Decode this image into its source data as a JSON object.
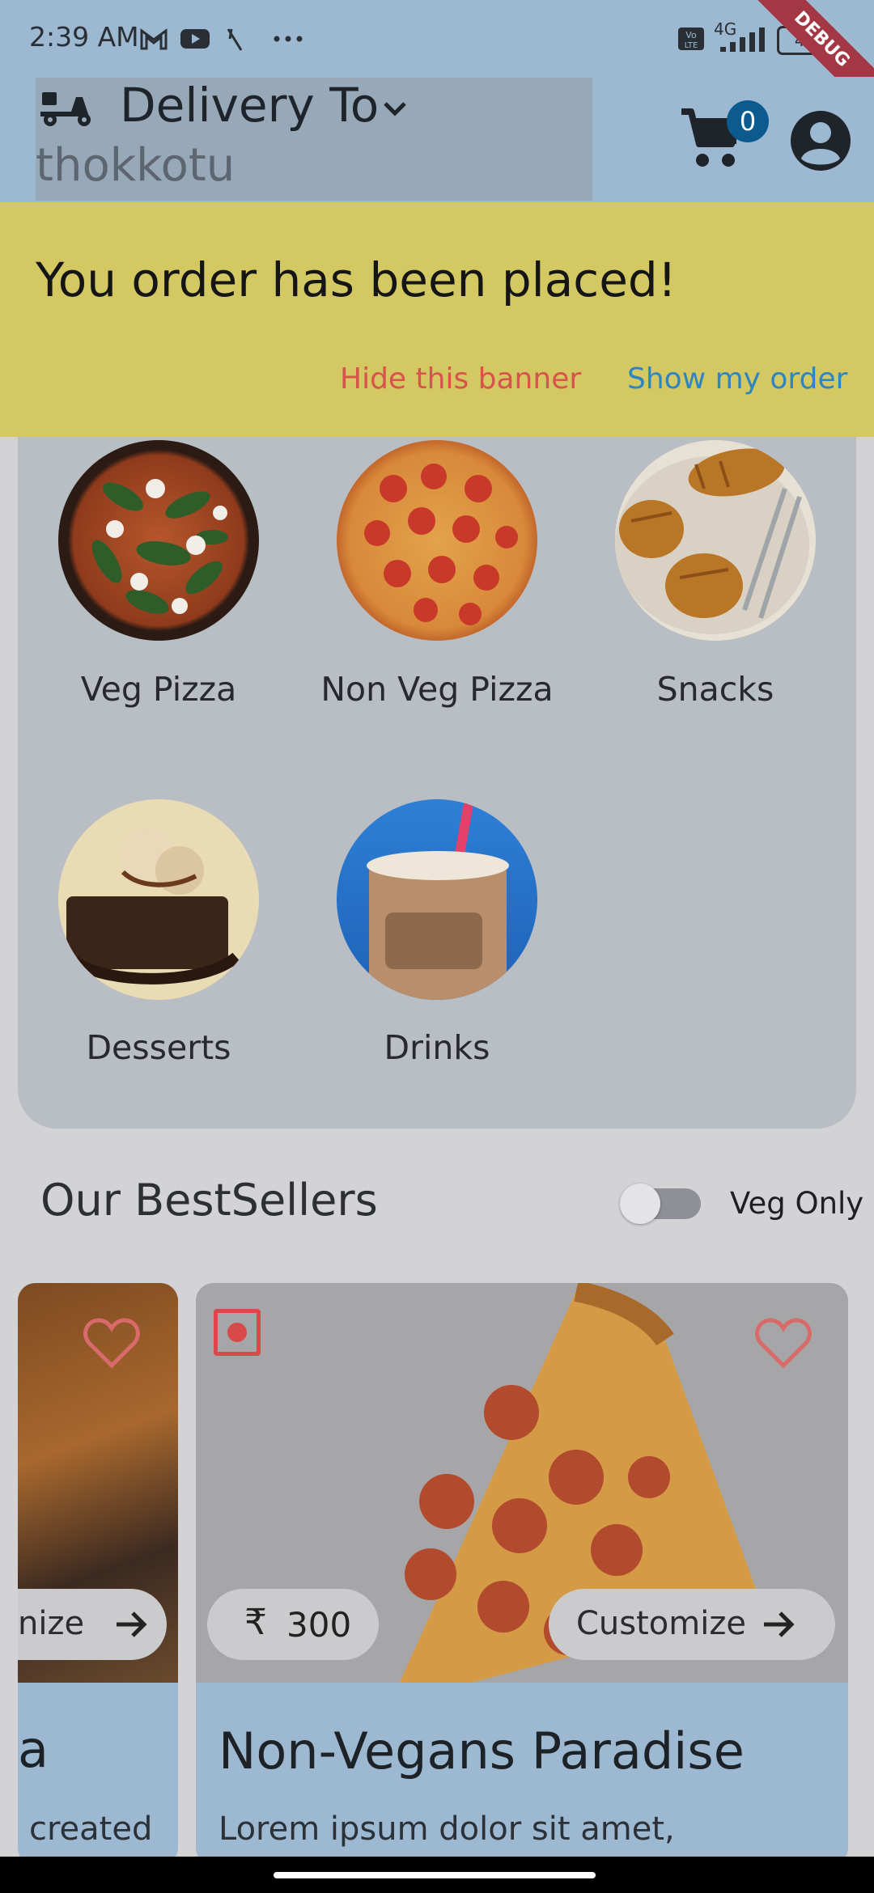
{
  "status_bar": {
    "time": "2:39 AM",
    "network": "4G",
    "battery": "4G"
  },
  "app_bar": {
    "delivery_label": "Delivery To",
    "location": "thokkotu",
    "cart_count": "0",
    "debug_ribbon": "DEBUG"
  },
  "banner": {
    "message": "You order has been placed!",
    "hide_label": "Hide this banner",
    "show_label": "Show my order"
  },
  "categories": [
    {
      "label": "Veg Pizza"
    },
    {
      "label": "Non Veg Pizza"
    },
    {
      "label": "Snacks"
    },
    {
      "label": "Desserts"
    },
    {
      "label": "Drinks"
    }
  ],
  "bestsellers": {
    "title": "Our BestSellers",
    "veg_only_label": "Veg Only",
    "veg_only_enabled": false,
    "cards": [
      {
        "customize_label": "nize",
        "title": "a",
        "description": "created"
      },
      {
        "price": "300",
        "currency": "₹",
        "customize_label": "Customize",
        "title": "Non-Vegans Paradise",
        "description": "Lorem ipsum dolor sit amet,"
      }
    ]
  },
  "colors": {
    "app_bar": "#9db9d2",
    "banner": "#d3c862",
    "hide_action": "#d8524e",
    "show_action": "#2e86c0",
    "cart_badge": "#0b5b8f",
    "nonveg_marker": "#d84a4a"
  }
}
